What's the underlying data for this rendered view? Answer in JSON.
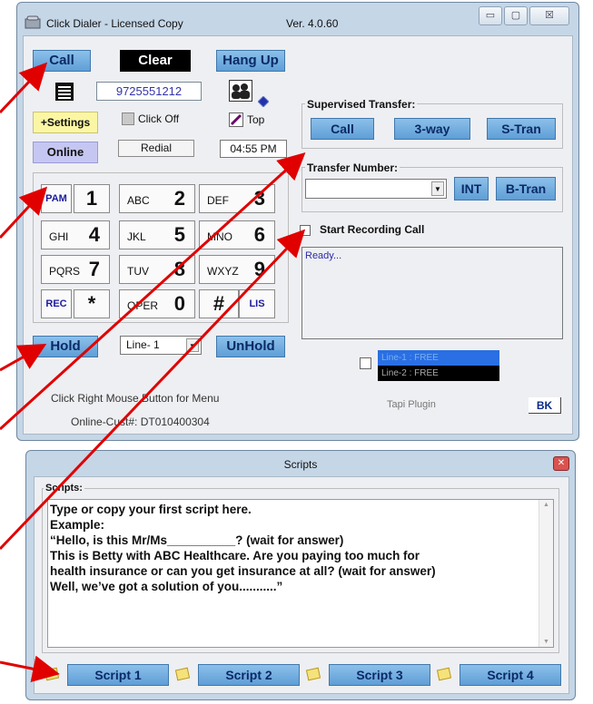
{
  "main_window": {
    "title": "Click Dialer  - Licensed Copy",
    "version": "Ver. 4.0.60",
    "controls": {
      "minimize": "▭",
      "maximize": "▢",
      "close": "☒"
    }
  },
  "toolbar": {
    "call": "Call",
    "clear": "Clear",
    "hang_up": "Hang Up"
  },
  "phone_number": "9725551212",
  "settings_label": "+Settings",
  "click_off_label": "Click Off",
  "top_label": "Top",
  "status": "Online",
  "redial": "Redial",
  "clock": "04:55 PM",
  "keypad": {
    "rows": [
      [
        {
          "side": "PAM"
        },
        {
          "letters": "",
          "digit": "1"
        },
        {
          "letters": "ABC",
          "digit": "2"
        },
        {
          "letters": "DEF",
          "digit": "3"
        }
      ],
      [
        {
          "letters": "GHI",
          "digit": "4"
        },
        {
          "letters": "JKL",
          "digit": "5"
        },
        {
          "letters": "MNO",
          "digit": "6"
        }
      ],
      [
        {
          "letters": "PQRS",
          "digit": "7"
        },
        {
          "letters": "TUV",
          "digit": "8"
        },
        {
          "letters": "WXYZ",
          "digit": "9"
        }
      ],
      [
        {
          "side": "REC"
        },
        {
          "letters": "",
          "digit": "*"
        },
        {
          "letters": "OPER",
          "digit": "0"
        },
        {
          "letters": "",
          "digit": "#"
        },
        {
          "side": "LIS"
        }
      ]
    ]
  },
  "hold": "Hold",
  "line_select": "Line- 1",
  "unhold": "UnHold",
  "hint": "Click Right Mouse Button for Menu",
  "customer": "Online-Cust#: DT010400304",
  "supervised_transfer": {
    "label": "Supervised Transfer:",
    "call": "Call",
    "three_way": "3-way",
    "s_tran": "S-Tran"
  },
  "transfer_number": {
    "label": "Transfer Number:",
    "int": "INT",
    "b_tran": "B-Tran"
  },
  "recording": {
    "label": "Start Recording Call"
  },
  "log_text": "Ready...",
  "lines": [
    "Line-1 : FREE",
    "Line-2 : FREE"
  ],
  "tapi": "Tapi Plugin",
  "bk": "BK",
  "scripts_window": {
    "title": "Scripts",
    "group_label": "Scripts:",
    "text_lines": [
      "Type or copy your first script here.",
      "Example:",
      "“Hello, is this Mr/Ms__________? (wait for answer)",
      "This is Betty with ABC Healthcare.  Are you paying too much for",
      "health insurance or can you get insurance at all?  (wait for answer)",
      "Well, we’ve got a solution of you...........”"
    ],
    "buttons": [
      "Script 1",
      "Script 2",
      "Script 3",
      "Script 4"
    ]
  },
  "colors": {
    "accent_blue": "#6aa6dc",
    "arrow_red": "#e00000",
    "window_frame": "#c5d6e7"
  }
}
